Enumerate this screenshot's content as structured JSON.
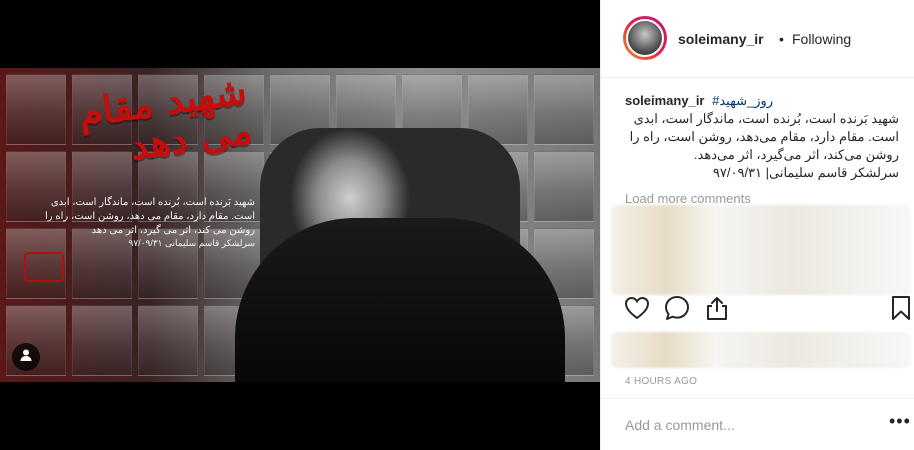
{
  "post": {
    "poster": {
      "title": "شهید مقام می دهد",
      "text": "شهید بَرنده است، بُرنده است، ماندگار است، ابدی است. مقام دارد، مقام می دهد، روشن است، راه را روشن می کند، اثر می گیرد، اثر می دهد",
      "signature": "سرلشکر قاسم سلیمانی ۹۷/۰۹/۳۱"
    }
  },
  "header": {
    "username": "soleimany_ir",
    "separator": "•",
    "follow_status": "Following"
  },
  "caption": {
    "username": "soleimany_ir",
    "hashtag": "#روز_شهید",
    "body": "شهید بَرنده است، بُرنده است، ماندگار است، ابدی است. مقام دارد، مقام می‌دهد، روشن است، راه را روشن می‌کند، اثر می‌گیرد، اثر می‌دهد.\nسرلشکر قاسم سلیمانی| ۹۷/۰۹/۳۱"
  },
  "comments": {
    "load_more": "Load more comments"
  },
  "timestamp": "4 HOURS AGO",
  "comment_box": {
    "placeholder": "Add a comment...",
    "more": "•••"
  },
  "icons": {
    "like": "heart-icon",
    "comment": "comment-icon",
    "share": "share-icon",
    "save": "bookmark-icon",
    "tag": "user-tag-icon"
  }
}
